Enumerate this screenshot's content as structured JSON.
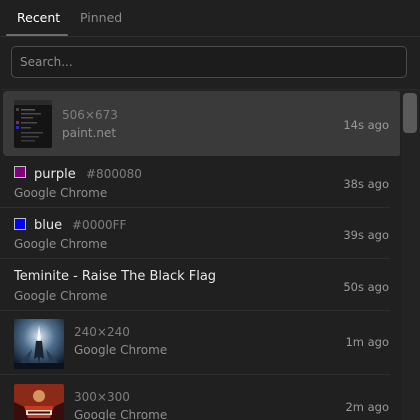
{
  "tabs": [
    {
      "label": "Recent",
      "active": true
    },
    {
      "label": "Pinned",
      "active": false
    }
  ],
  "search": {
    "placeholder": "Search..."
  },
  "items": [
    {
      "kind": "image",
      "dimensions": "506×673",
      "source": "paint.net",
      "time": "14s ago",
      "selected": true
    },
    {
      "kind": "color",
      "name": "purple",
      "hex": "#800080",
      "source": "Google Chrome",
      "time": "38s ago",
      "swatch": "#800080"
    },
    {
      "kind": "color",
      "name": "blue",
      "hex": "#0000FF",
      "source": "Google Chrome",
      "time": "39s ago",
      "swatch": "#0000FF"
    },
    {
      "kind": "text",
      "text": "Teminite - Raise The Black Flag",
      "source": "Google Chrome",
      "time": "50s ago"
    },
    {
      "kind": "image",
      "dimensions": "240×240",
      "source": "Google Chrome",
      "time": "1m ago"
    },
    {
      "kind": "image",
      "dimensions": "300×300",
      "source": "Google Chrome",
      "time": "2m ago"
    }
  ],
  "icons": {
    "thumb_1": "app-screenshot-thumbnail",
    "thumb_2": "album-art-thumbnail",
    "thumb_3": "album-art-thumbnail"
  },
  "colors": {
    "background": "#202020",
    "selected_row": "#3a3a3a",
    "divider": "#2e2e2e"
  }
}
